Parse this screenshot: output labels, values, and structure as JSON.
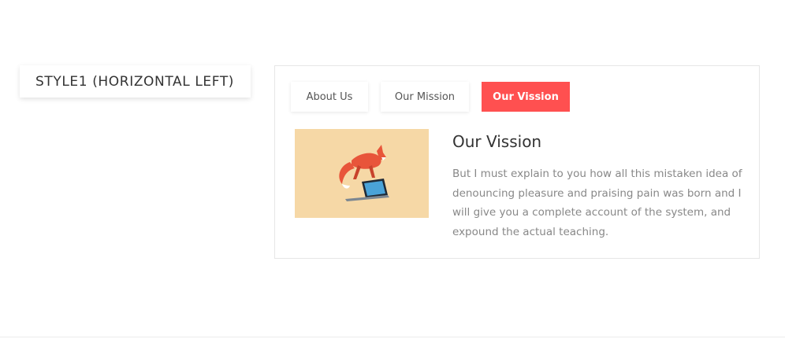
{
  "style_label": "STYLE1 (HORIZONTAL LEFT)",
  "tabs": [
    {
      "label": "About Us",
      "active": false
    },
    {
      "label": "Our Mission",
      "active": false
    },
    {
      "label": "Our Vission",
      "active": true
    }
  ],
  "content": {
    "heading": "Our Vission",
    "body": "But I must explain to you how all this mistaken idea of denouncing pleasure and praising pain was born and I will give you a complete account of the system, and expound the actual teaching."
  },
  "colors": {
    "accent": "#ff5050",
    "image_bg": "#f6d8a6"
  },
  "icons": {
    "image": "fox-laptop-illustration"
  }
}
